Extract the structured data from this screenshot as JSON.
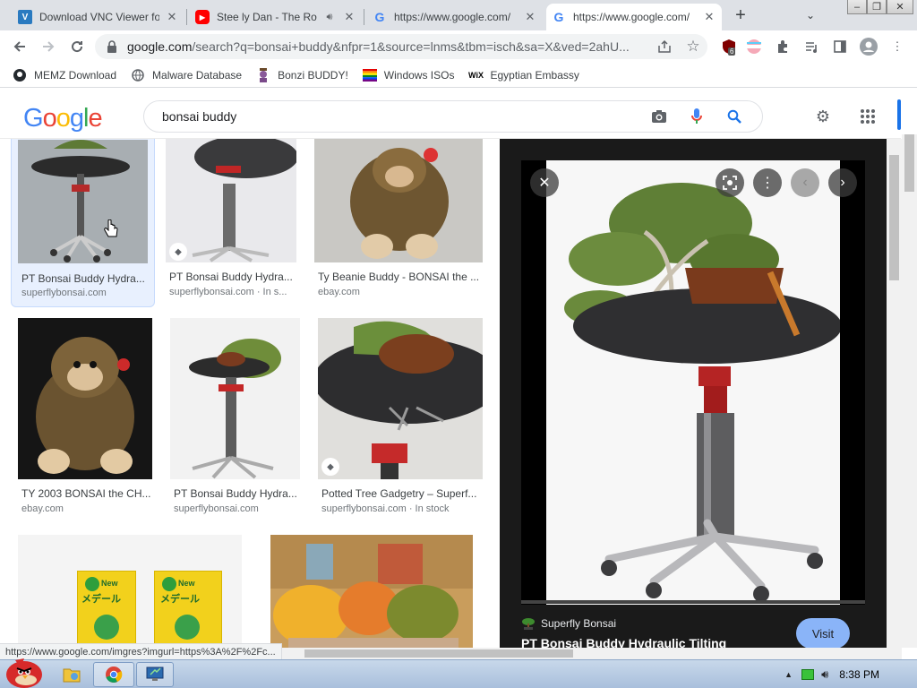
{
  "browser": {
    "tabs": [
      {
        "title": "Download VNC Viewer fo",
        "icon": "vnc-icon",
        "active": false
      },
      {
        "title": "Stee ly Dan - The Roy",
        "icon": "youtube-icon",
        "active": false,
        "audio": true
      },
      {
        "title": "https://www.google.com/",
        "icon": "google-icon",
        "active": false
      },
      {
        "title": "https://www.google.com/",
        "icon": "google-icon",
        "active": true
      }
    ],
    "new_tab": "+",
    "url_host": "google.com",
    "url_path": "/search?q=bonsai+buddy&nfpr=1&source=lnms&tbm=isch&sa=X&ved=2ahU...",
    "extension_badge": "6"
  },
  "bookmarks": [
    {
      "label": "MEMZ Download",
      "icon": "github-icon"
    },
    {
      "label": "Malware Database",
      "icon": "globe-icon"
    },
    {
      "label": "Bonzi BUDDY!",
      "icon": "bonzi-icon"
    },
    {
      "label": "Windows ISOs",
      "icon": "windows-flag-icon"
    },
    {
      "label": "Egyptian Embassy",
      "icon": "wix-icon"
    }
  ],
  "google": {
    "logo": "Google",
    "query": "bonsai buddy"
  },
  "results": [
    {
      "title": "PT Bonsai Buddy Hydra...",
      "source": "superflybonsai.com",
      "selected": true
    },
    {
      "title": "PT Bonsai Buddy Hydra...",
      "source": "superflybonsai.com · In s..."
    },
    {
      "title": "Ty Beanie Buddy - BONSAI the ...",
      "source": "ebay.com"
    },
    {
      "title": "TY 2003 BONSAI the CH...",
      "source": "ebay.com"
    },
    {
      "title": "PT Bonsai Buddy Hydra...",
      "source": "superflybonsai.com"
    },
    {
      "title": "Potted Tree Gadgetry – Superf...",
      "source": "superflybonsai.com · In stock"
    },
    {
      "title": "",
      "source": "",
      "label_big": "New",
      "label_jp": "メデール"
    },
    {
      "title": "",
      "source": ""
    }
  ],
  "preview": {
    "site": "Superfly Bonsai",
    "title": "PT Bonsai Buddy Hydraulic Tilting",
    "visit_label": "Visit"
  },
  "status_url": "https://www.google.com/imgres?imgurl=https%3A%2F%2Fc...",
  "taskbar": {
    "clock": "8:38 PM"
  },
  "colors": {
    "google_blue": "#4285F4",
    "google_red": "#EA4335",
    "google_yellow": "#FBBC05",
    "google_green": "#34A853",
    "visit_button": "#8ab4f8"
  }
}
